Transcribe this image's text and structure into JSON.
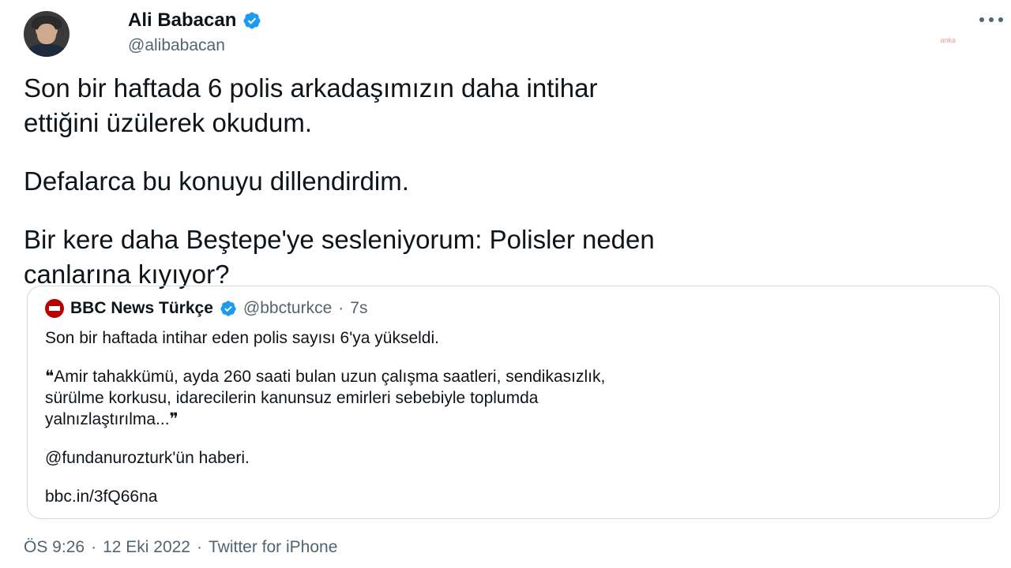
{
  "author": {
    "name": "Ali Babacan",
    "handle": "@alibabacan"
  },
  "watermark": "anka",
  "tweet": {
    "lines": [
      "Son bir haftada 6 polis arkadaşımızın daha intihar",
      "ettiğini üzülerek okudum.",
      "Defalarca bu konuyu dillendirdim.",
      "Bir kere daha Beştepe'ye sesleniyorum: Polisler neden",
      "canlarına kıyıyor?"
    ]
  },
  "quote": {
    "name": "BBC News Türkçe",
    "handle": "@bbcturkce",
    "dot": "·",
    "time": "7s",
    "lines": [
      "Son bir haftada intihar eden polis sayısı 6'ya yükseldi.",
      "❝Amir tahakkümü, ayda 260 saati bulan uzun çalışma saatleri, sendikasızlık,",
      "sürülme korkusu, idarecilerin kanunsuz emirleri sebebiyle toplumda",
      "yalnızlaştırılma...❞",
      "@fundanurozturk'ün haberi.",
      "bbc.in/3fQ66na"
    ]
  },
  "footer": {
    "time": "ÖS 9:26",
    "dot1": "·",
    "date": "12 Eki 2022",
    "dot2": "·",
    "source": "Twitter for iPhone"
  },
  "colors": {
    "verified": "#1d9bf0",
    "secondary_text": "#536471",
    "bbc_red": "#b80000"
  },
  "icons": [
    "verified-badge-icon",
    "more-icon",
    "bbc-logo-icon"
  ]
}
